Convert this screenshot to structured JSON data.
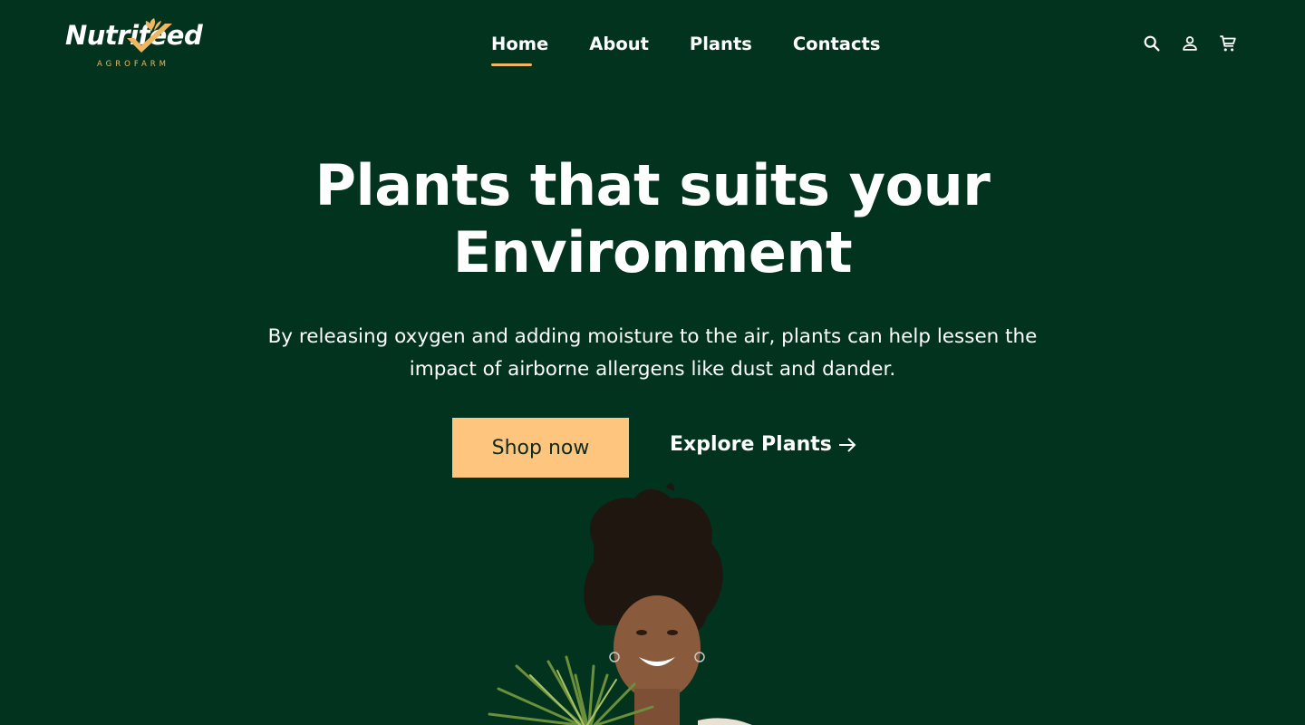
{
  "brand": {
    "name": "Nutrifeed",
    "tagline": "AGROFARM",
    "accent_color": "#f0b661",
    "background_color": "#02331e"
  },
  "nav": {
    "items": [
      {
        "label": "Home",
        "active": true
      },
      {
        "label": "About",
        "active": false
      },
      {
        "label": "Plants",
        "active": false
      },
      {
        "label": "Contacts",
        "active": false
      }
    ]
  },
  "header_icons": [
    "search-icon",
    "user-icon",
    "cart-icon"
  ],
  "hero": {
    "title_line1": "Plants that suits your",
    "title_line2": "Environment",
    "description_line1": "By releasing oxygen and adding moisture to the air, plants can help lessen the",
    "description_line2": "impact of airborne allergens like dust and dander.",
    "primary_button": "Shop now",
    "primary_button_color": "#fec57e",
    "secondary_link": "Explore Plants",
    "secondary_link_icon": "arrow-right-icon"
  }
}
